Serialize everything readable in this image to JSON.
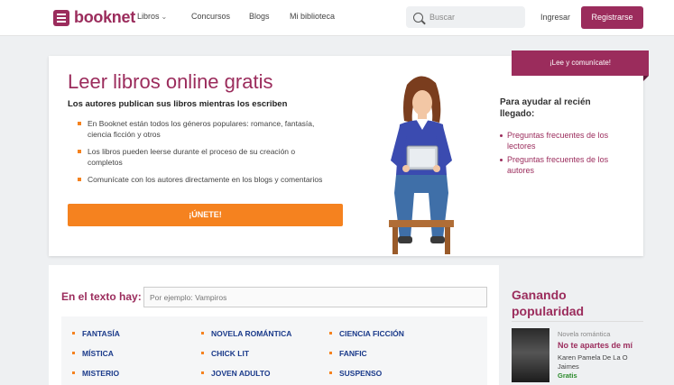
{
  "header": {
    "logo": "booknet",
    "nav": [
      {
        "label": "Libros",
        "has_dropdown": true
      },
      {
        "label": "Concursos"
      },
      {
        "label": "Blogs"
      },
      {
        "label": "Mi biblioteca"
      }
    ],
    "search_placeholder": "Buscar",
    "login_label": "Ingresar",
    "register_label": "Registrarse"
  },
  "hero": {
    "title": "Leer libros online gratis",
    "subtitle": "Los autores publican sus libros mientras los escriben",
    "bullets": [
      "En Booknet están todos los géneros populares: romance, fantasía, ciencia ficción y otros",
      "Los libros pueden leerse durante el proceso de su creación o completos",
      "Comunícate con los autores directamente en los blogs y comentarios"
    ],
    "join_label": "¡ÚNETE!",
    "ribbon_label": "¡Lee y comunícate!",
    "help_title": "Para ayudar al recién llegado:",
    "help_links": [
      "Preguntas frecuentes de los lectores",
      "Preguntas frecuentes de los autores"
    ]
  },
  "search_section": {
    "label": "En el texto hay:",
    "placeholder": "Por ejemplo: Vampiros",
    "genres": [
      [
        "FANTASÍA",
        "NOVELA ROMÁNTICA",
        "CIENCIA FICCIÓN"
      ],
      [
        "MÍSTICA",
        "CHICK LIT",
        "FANFIC"
      ],
      [
        "MISTERIO",
        "JOVEN ADULTO",
        "SUSPENSO"
      ]
    ]
  },
  "popular": {
    "title": "Ganando popularidad",
    "book": {
      "genre": "Novela romántica",
      "title": "No te apartes de mí",
      "author": "Karen Pamela De La O Jaimes",
      "price": "Gratis"
    }
  },
  "colors": {
    "brand": "#9b2c5c",
    "accent": "#f5821f",
    "genre_link": "#1a3a8a"
  }
}
